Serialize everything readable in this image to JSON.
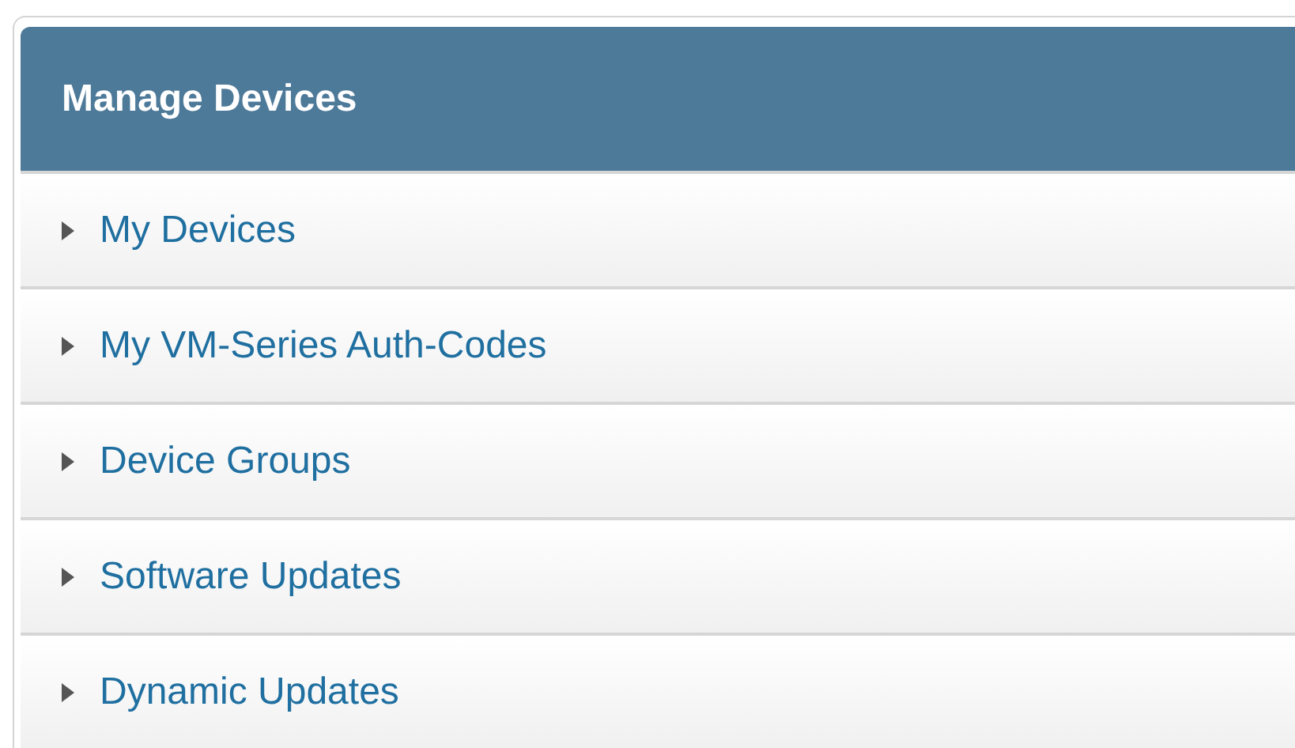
{
  "panel": {
    "title": "Manage Devices",
    "items": [
      {
        "label": "My Devices",
        "expanded": false
      },
      {
        "label": "My VM-Series Auth-Codes",
        "expanded": false
      },
      {
        "label": "Device Groups",
        "expanded": false
      },
      {
        "label": "Software Updates",
        "expanded": false
      },
      {
        "label": "Dynamic Updates",
        "expanded": false
      }
    ]
  }
}
